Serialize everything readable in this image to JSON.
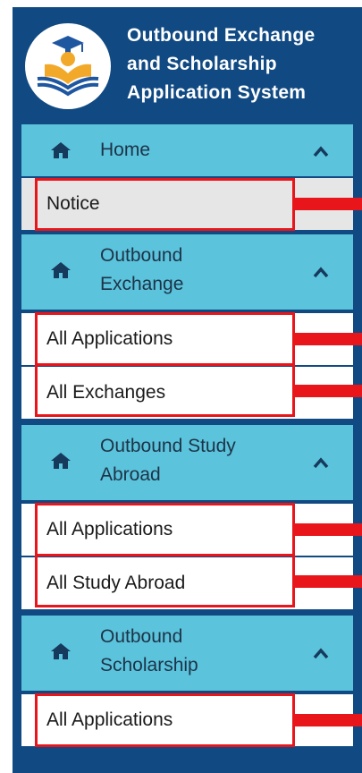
{
  "app": {
    "title_lines": [
      "Outbound Exchange",
      "and Scholarship",
      "Application System"
    ]
  },
  "colors": {
    "sidebar_bg": "#114a83",
    "section_bg": "#5bc3dc",
    "highlight": "#e8151b",
    "selected_item_bg": "#e6e6e6"
  },
  "nav": {
    "sections": [
      {
        "label_lines": [
          "Home"
        ],
        "icon": "home-icon",
        "chevron": "chevron-up-icon",
        "items": [
          {
            "label": "Notice",
            "selected": true
          }
        ]
      },
      {
        "label_lines": [
          "Outbound",
          "Exchange"
        ],
        "icon": "home-icon",
        "chevron": "chevron-up-icon",
        "items": [
          {
            "label": "All Applications"
          },
          {
            "label": "All Exchanges"
          }
        ]
      },
      {
        "label_lines": [
          "Outbound Study",
          "Abroad"
        ],
        "icon": "home-icon",
        "chevron": "chevron-up-icon",
        "items": [
          {
            "label": "All Applications"
          },
          {
            "label": "All Study Abroad"
          }
        ]
      },
      {
        "label_lines": [
          "Outbound",
          "Scholarship"
        ],
        "icon": "home-icon",
        "chevron": "chevron-up-icon",
        "items": [
          {
            "label": "All Applications"
          }
        ]
      }
    ]
  }
}
